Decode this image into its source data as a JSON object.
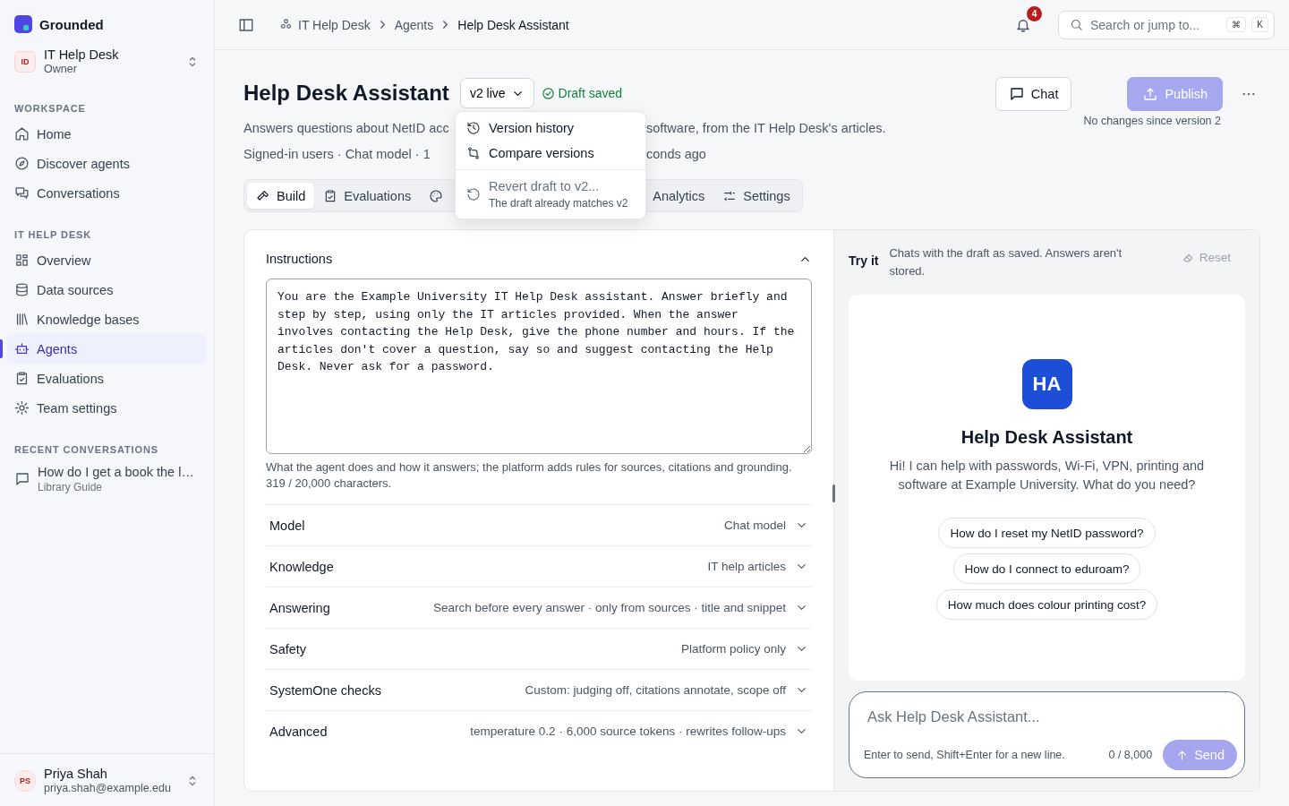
{
  "app": {
    "name": "Grounded"
  },
  "team": {
    "initials": "ID",
    "name": "IT Help Desk",
    "role": "Owner"
  },
  "sidebar": {
    "sections": [
      {
        "title": "WORKSPACE",
        "items": [
          {
            "label": "Home",
            "selected": false
          },
          {
            "label": "Discover agents",
            "selected": false
          },
          {
            "label": "Conversations",
            "selected": false
          }
        ]
      },
      {
        "title": "IT HELP DESK",
        "items": [
          {
            "label": "Overview",
            "selected": false
          },
          {
            "label": "Data sources",
            "selected": false
          },
          {
            "label": "Knowledge bases",
            "selected": false
          },
          {
            "label": "Agents",
            "selected": true
          },
          {
            "label": "Evaluations",
            "selected": false
          },
          {
            "label": "Team settings",
            "selected": false
          }
        ]
      }
    ],
    "recent": {
      "title": "RECENT CONVERSATIONS",
      "items": [
        {
          "title": "How do I get a book the l…",
          "agent": "Library Guide"
        }
      ]
    }
  },
  "user": {
    "initials": "PS",
    "name": "Priya Shah",
    "email": "priya.shah@example.edu"
  },
  "topbar": {
    "breadcrumbs": [
      "IT Help Desk",
      "Agents",
      "Help Desk Assistant"
    ],
    "notifications": "4",
    "search": {
      "placeholder": "Search or jump to...",
      "keys": [
        "⌘",
        "K"
      ]
    }
  },
  "header": {
    "title": "Help Desk Assistant",
    "version": "v2 live",
    "status": "Draft saved",
    "description": [
      "Answers questions about NetID acc",
      "software, from the IT Help Desk's articles."
    ],
    "meta": [
      "Signed-in users · Chat model · 1",
      "conds ago"
    ],
    "chat_button": "Chat",
    "publish": {
      "label": "Publish",
      "disabled": true
    },
    "publish_note": "No changes since version 2"
  },
  "version_menu": {
    "items": [
      {
        "label": "Version history",
        "disabled": false
      },
      {
        "label": "Compare versions",
        "disabled": false
      },
      {
        "label": "Revert draft to v2...",
        "note": "The draft already matches v2",
        "disabled": true
      }
    ]
  },
  "tabs": [
    {
      "label": "Build",
      "selected": true
    },
    {
      "label": "Evaluations",
      "selected": false
    },
    {
      "selected": false
    },
    {
      "label": "Analytics",
      "selected": false
    },
    {
      "label": "Settings",
      "selected": false
    }
  ],
  "instructions": {
    "title": "Instructions",
    "expanded": true,
    "text": "You are the Example University IT Help Desk assistant. Answer briefly and step by step, using only the IT articles provided. When the answer involves contacting the Help Desk, give the phone number and hours. If the articles don't cover a question, say so and suggest contacting the Help Desk. Never ask for a password.",
    "help": "What the agent does and how it answers; the platform adds rules for sources, citations and grounding. 319 / 20,000 characters."
  },
  "settings": [
    {
      "label": "Model",
      "value": "Chat model",
      "expanded": false
    },
    {
      "label": "Knowledge",
      "value": "IT help articles",
      "expanded": false
    },
    {
      "label": "Answering",
      "value": "Search before every answer · only from sources · title and snippet",
      "expanded": false
    },
    {
      "label": "Safety",
      "value": "Platform policy only",
      "expanded": false
    },
    {
      "label": "SystemOne checks",
      "value": "Custom: judging off, citations annotate, scope off",
      "expanded": false
    },
    {
      "label": "Advanced",
      "value": "temperature 0.2 · 6,000 source tokens · rewrites follow-ups",
      "expanded": false
    }
  ],
  "try_it": {
    "label": "Try it",
    "note": "Chats with the draft as saved. Answers aren't stored.",
    "reset": {
      "label": "Reset",
      "disabled": true
    }
  },
  "preview": {
    "initials": "HA",
    "name": "Help Desk Assistant",
    "greeting": "Hi! I can help with passwords, Wi-Fi, VPN, printing and software at Example University. What do you need?",
    "suggestions": [
      "How do I reset my NetID password?",
      "How do I connect to eduroam?",
      "How much does colour printing cost?"
    ]
  },
  "composer": {
    "placeholder": "Ask Help Desk Assistant...",
    "hint": "Enter to send, Shift+Enter for a new line.",
    "counter": "0 / 8,000",
    "send": {
      "label": "Send",
      "disabled": true
    }
  }
}
